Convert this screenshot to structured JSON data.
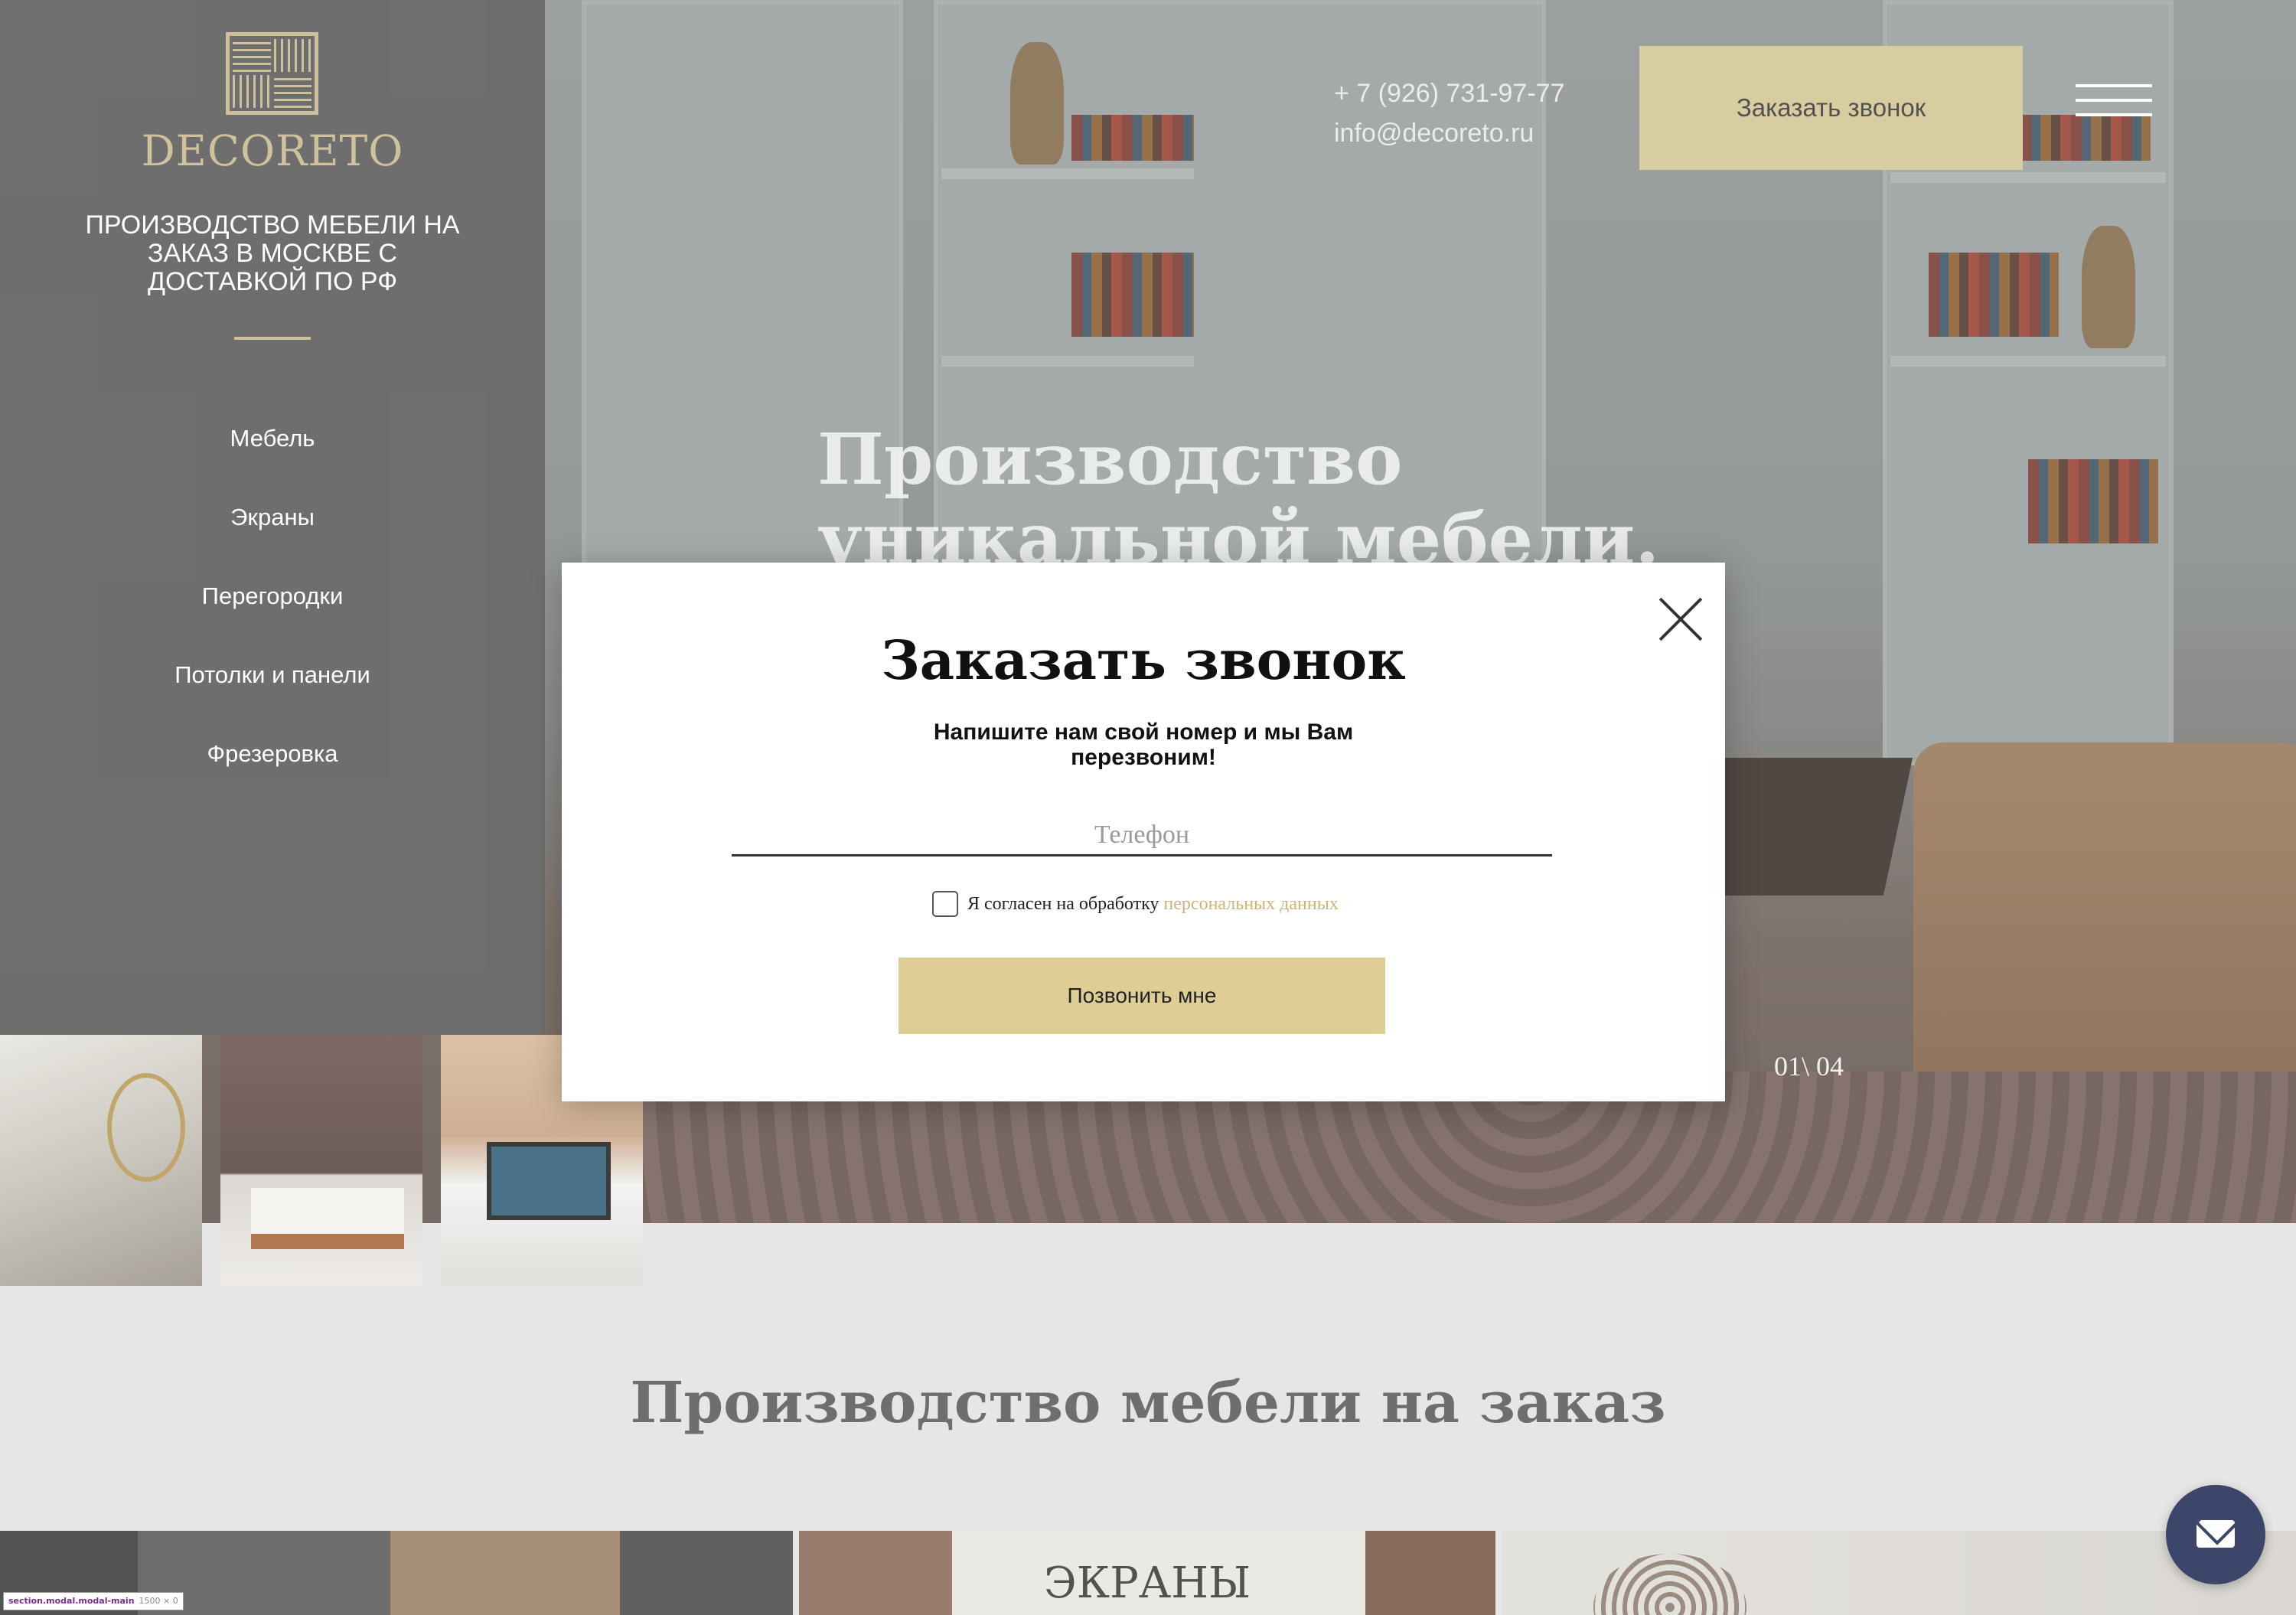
{
  "brand": {
    "name": "DECORETO",
    "tagline": "ПРОИЗВОДСТВО МЕБЕЛИ НА ЗАКАЗ В МОСКВЕ С ДОСТАВКОЙ ПО РФ",
    "accent": "#c9b98e"
  },
  "nav": {
    "items": [
      {
        "label": "Мебель"
      },
      {
        "label": "Экраны"
      },
      {
        "label": "Перегородки"
      },
      {
        "label": "Потолки и панели"
      },
      {
        "label": "Фрезеровка"
      }
    ]
  },
  "header": {
    "phone": "+ 7 (926) 731-97-77",
    "email": "info@decoreto.ru",
    "cta_label": "Заказать звонок",
    "cta_color": "#d3c594"
  },
  "hero": {
    "heading": "Производство уникальной мебели.",
    "slide_counter": "01\\ 04"
  },
  "section": {
    "title": "Производство мебели на заказ",
    "cards": [
      {
        "label": ""
      },
      {
        "label": "ЭКРАНЫ"
      },
      {
        "label": ""
      }
    ]
  },
  "modal": {
    "title": "Заказать звонок",
    "subtitle": "Напишите нам свой номер и мы Вам перезвоним!",
    "phone_placeholder": "Телефон",
    "consent_text": "Я согласен на обработку",
    "consent_link": "персональных данных",
    "consent_checked": false,
    "submit_label": "Позвонить мне",
    "button_color": "#dfcd96"
  },
  "chat_widget": {
    "icon": "envelope-icon",
    "color": "#3c466b"
  },
  "devtools": {
    "selector": "section.modal.modal-main",
    "dims": "1500 × 0"
  }
}
